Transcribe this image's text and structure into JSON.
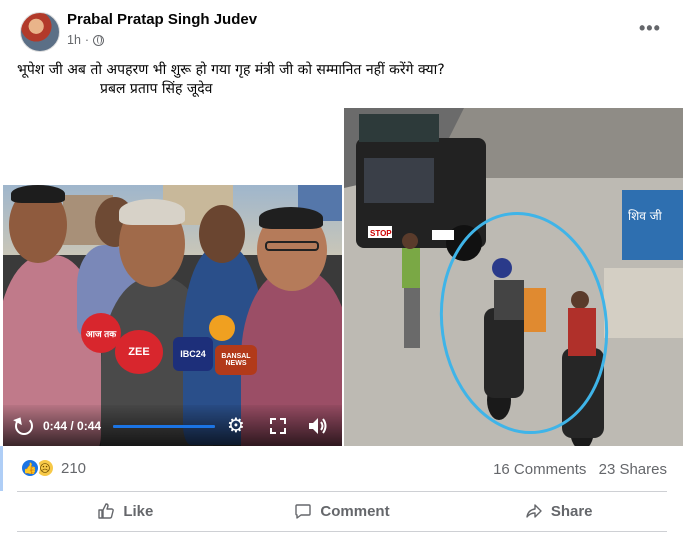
{
  "post": {
    "author": "Prabal Pratap Singh Judev",
    "time": "1h",
    "time_separator": "·",
    "more": "•••",
    "text_line1": "भूपेश जी अब तो अपहरण भी शुरू हो गया गृह मंत्री जी को सम्मानित नहीं करेंगे क्या?",
    "text_line2": "प्रबल प्रताप सिंह जूदेव"
  },
  "video": {
    "time": "0:44 / 0:44",
    "progress": 1.0,
    "mics": [
      "आज तक",
      "ZEE",
      "IBC24",
      "BANSAL NEWS"
    ]
  },
  "photo": {
    "jeep_plate": "STOP",
    "shop_sign": "शिव जी"
  },
  "engagement": {
    "reaction_count": "210",
    "comments": "16 Comments",
    "shares": "23 Shares"
  },
  "actions": {
    "like": "Like",
    "comment": "Comment",
    "share": "Share"
  },
  "colors": {
    "accent": "#1b74e4",
    "secondary_text": "#65676b",
    "circle_annotation": "#3fb4e8"
  }
}
